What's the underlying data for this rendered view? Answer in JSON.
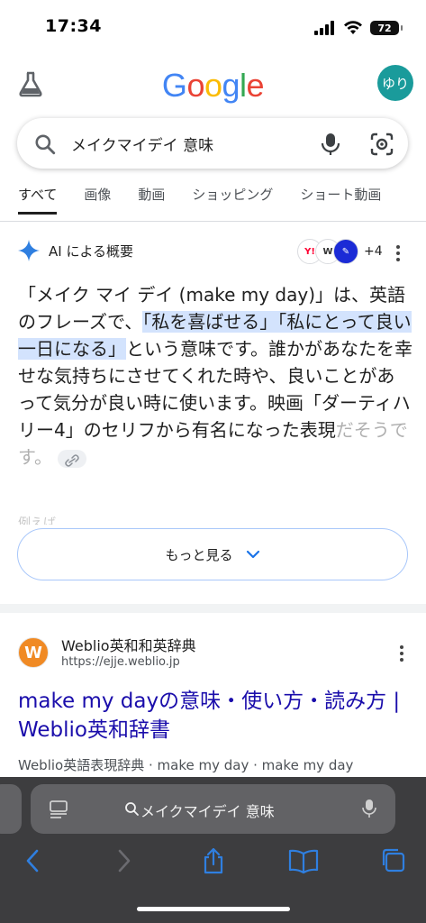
{
  "status": {
    "time": "17:34",
    "battery": "72"
  },
  "header": {
    "logo_letters": [
      {
        "ch": "G",
        "color": "#4285F4"
      },
      {
        "ch": "o",
        "color": "#EA4335"
      },
      {
        "ch": "o",
        "color": "#FBBC05"
      },
      {
        "ch": "g",
        "color": "#4285F4"
      },
      {
        "ch": "l",
        "color": "#34A853"
      },
      {
        "ch": "e",
        "color": "#EA4335"
      }
    ],
    "avatar_text": "ゆり",
    "avatar_color": "#1a9b9b"
  },
  "search": {
    "query": "メイクマイデイ 意味"
  },
  "tabs": [
    {
      "label": "すべて",
      "active": true
    },
    {
      "label": "画像"
    },
    {
      "label": "動画"
    },
    {
      "label": "ショッピング"
    },
    {
      "label": "ショート動画"
    }
  ],
  "ai_overview": {
    "title": "AI による概要",
    "more_sources": "+4",
    "body_part1": "「メイク マイ デイ (make my day)」は、英語のフレーズで、",
    "body_highlight": "「私を喜ばせる」「私にとって良い一日になる」",
    "body_part2": "という意味です。誰かがあなたを幸せな気持ちにさせてくれた時や、良いことがあって気分が良い時に使います。映画「ダーティハリー4」のセリフから有名になった表現",
    "body_fade": "だそうです。",
    "fade_line": "例えば",
    "more_button": "もっと見る"
  },
  "result": {
    "favicon_letter": "W",
    "site_name": "Weblio英和和英辞典",
    "url": "https://ejje.weblio.jp",
    "title": "make my dayの意味・使い方・読み方 | Weblio英和辞書",
    "snippet": "Weblio英語表現辞典 · make my day · make my day"
  },
  "safari": {
    "url_text": "メイクマイデイ 意味"
  },
  "colors": {
    "accent": "#1a73e8",
    "link": "#1a0dab",
    "highlight": "#d3e3fd",
    "safari_bar": "#3d3d3f",
    "ios_blue": "#2f7fe0"
  }
}
